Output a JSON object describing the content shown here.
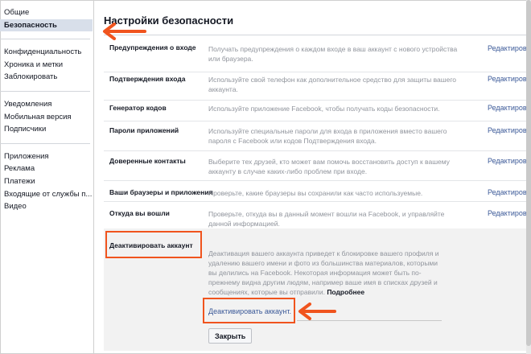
{
  "sidebar": {
    "groups": [
      {
        "items": [
          {
            "label": "Общие"
          },
          {
            "label": "Безопасность"
          }
        ]
      },
      {
        "items": [
          {
            "label": "Конфиденциальность"
          },
          {
            "label": "Хроника и метки"
          },
          {
            "label": "Заблокировать"
          }
        ]
      },
      {
        "items": [
          {
            "label": "Уведомления"
          },
          {
            "label": "Мобильная версия"
          },
          {
            "label": "Подписчики"
          }
        ]
      },
      {
        "items": [
          {
            "label": "Приложения"
          },
          {
            "label": "Реклама"
          },
          {
            "label": "Платежи"
          },
          {
            "label": "Входящие от службы п..."
          },
          {
            "label": "Видео"
          }
        ]
      }
    ]
  },
  "main": {
    "title": "Настройки безопасности",
    "edit_label": "Редактировать",
    "rows": [
      {
        "label": "Предупреждения о входе",
        "description": "Получать предупреждения о каждом входе в ваш аккаунт с нового устройства или браузера."
      },
      {
        "label": "Подтверждения входа",
        "description": "Используйте свой телефон как дополнительное средство для защиты вашего аккаунта."
      },
      {
        "label": "Генератор кодов",
        "description": "Используйте приложение Facebook, чтобы получать коды безопасности."
      },
      {
        "label": "Пароли приложений",
        "description": "Используйте специальные пароли для входа в приложения вместо вашего пароля с Facebook или кодов Подтверждения входа."
      },
      {
        "label": "Доверенные контакты",
        "description": "Выберите тех друзей, кто может вам помочь восстановить доступ к вашему аккаунту в случае каких-либо проблем при входе."
      },
      {
        "label": "Ваши браузеры и приложения",
        "description": "Проверьте, какие браузеры вы сохранили как часто используемые."
      },
      {
        "label": "Откуда вы вошли",
        "description": "Проверьте, откуда вы в данный момент вошли на Facebook, и управляйте данной информацией."
      }
    ],
    "deactivate": {
      "label": "Деактивировать аккаунт",
      "description": "Деактивация вашего аккаунта приведет к блокировке вашего профиля и удалению вашего имени и фото из большинства материалов, которыми вы делились на Facebook. Некоторая информация может быть по-прежнему видна другим людям, например ваше имя в списках друзей и сообщениях, которые вы отправили.",
      "more_link": "Подробнее",
      "link": "Деактивировать аккаунт.",
      "close_button": "Закрыть"
    }
  },
  "colors": {
    "accent": "#3b5998",
    "annotation": "#f0541e",
    "active_bg": "#d8dfea",
    "deactivate_bg": "#f2f2f2"
  },
  "icons": {
    "annotation_arrow": "left-arrow-icon"
  }
}
